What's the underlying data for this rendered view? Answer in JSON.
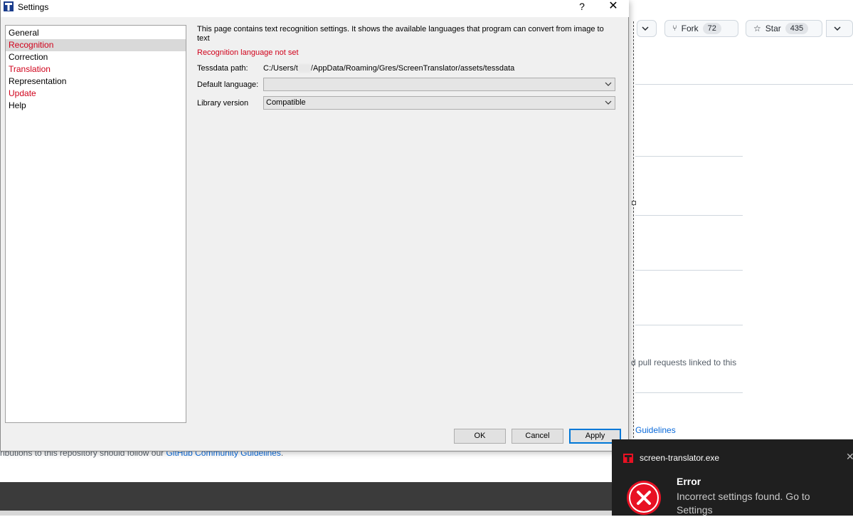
{
  "background_page": {
    "fork_label": "Fork",
    "fork_count": "72",
    "star_label": "Star",
    "star_count": "435",
    "linked_text": "d pull requests linked to this",
    "guidelines_link": "Guidelines",
    "contrib_prefix": "ributions to this repository should follow our ",
    "contrib_link": "GitHub Community Guidelines",
    "contrib_suffix": "."
  },
  "dialog": {
    "title": "Settings",
    "help_glyph": "?",
    "close_glyph": "✕",
    "sidebar": {
      "items": [
        {
          "label": "General",
          "error": false,
          "selected": false
        },
        {
          "label": "Recognition",
          "error": true,
          "selected": true
        },
        {
          "label": "Correction",
          "error": false,
          "selected": false
        },
        {
          "label": "Translation",
          "error": true,
          "selected": false
        },
        {
          "label": "Representation",
          "error": false,
          "selected": false
        },
        {
          "label": "Update",
          "error": true,
          "selected": false
        },
        {
          "label": "Help",
          "error": false,
          "selected": false
        }
      ]
    },
    "recognition": {
      "description": "This page contains text recognition settings. It shows the available languages that program can convert from image to text",
      "error_message": "Recognition language not set",
      "tessdata_label": "Tessdata path:",
      "tessdata_prefix": "C:/Users/t",
      "tessdata_suffix": "/AppData/Roaming/Gres/ScreenTranslator/assets/tessdata",
      "default_language_label": "Default language:",
      "default_language_value": "",
      "library_version_label": "Library version",
      "library_version_value": "Compatible"
    },
    "buttons": {
      "ok": "OK",
      "cancel": "Cancel",
      "apply": "Apply"
    }
  },
  "toast": {
    "app_name": "screen-translator.exe",
    "close_glyph": "✕",
    "title": "Error",
    "message": "Incorrect settings found. Go to Settings"
  },
  "colors": {
    "error_red": "#d0021b",
    "accent_blue": "#0078d7",
    "toast_bg": "#1f1f1f",
    "error_icon": "#e81123"
  }
}
